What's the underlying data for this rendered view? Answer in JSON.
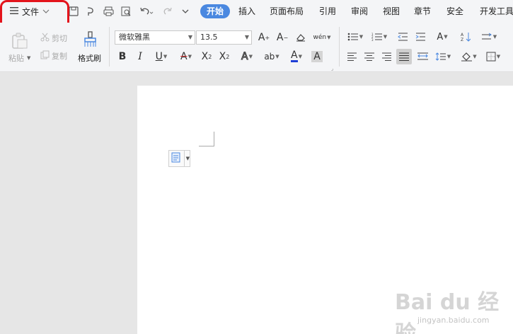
{
  "menubar": {
    "file_label": "文件",
    "tabs": [
      "开始",
      "插入",
      "页面布局",
      "引用",
      "审阅",
      "视图",
      "章节",
      "安全",
      "开发工具"
    ],
    "active_tab": "开始"
  },
  "clipboard": {
    "paste_label": "粘贴",
    "cut_label": "剪切",
    "copy_label": "复制",
    "format_painter_label": "格式刷"
  },
  "font": {
    "family": "微软雅黑",
    "size": "13.5",
    "phonetic_label": "wén"
  },
  "watermark": {
    "brand": "Bai du 经验",
    "url": "jingyan.baidu.com"
  },
  "colors": {
    "accent": "#4a88e0",
    "highlight_ring": "#e3141c",
    "font_color_bar": "#1f3fd6",
    "strike_color": "#e03a3a"
  }
}
